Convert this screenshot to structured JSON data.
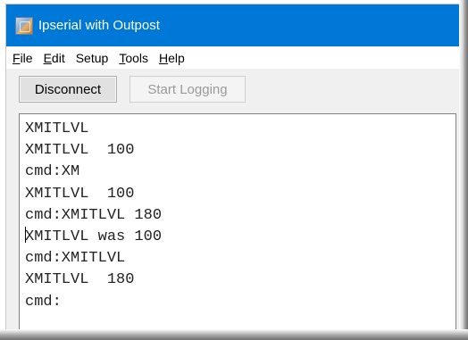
{
  "window": {
    "title": "Ipserial with Outpost",
    "icon": "app-icon"
  },
  "menu": [
    {
      "key": "file",
      "accel": "F",
      "rest": "ile"
    },
    {
      "key": "edit",
      "accel": "E",
      "rest": "dit"
    },
    {
      "key": "setup",
      "accel": "",
      "rest": "Setup"
    },
    {
      "key": "tools",
      "accel": "T",
      "rest": "ools"
    },
    {
      "key": "help",
      "accel": "H",
      "rest": "elp"
    }
  ],
  "toolbar": {
    "disconnect_label": "Disconnect",
    "start_logging_label": "Start Logging",
    "start_logging_enabled": false
  },
  "terminal": {
    "lines": [
      "XMITLVL",
      "XMITLVL  100",
      "cmd:XM",
      "XMITLVL  100",
      "cmd:XMITLVL 180",
      "XMITLVL was 100",
      "cmd:XMITLVL",
      "XMITLVL  180",
      "cmd:"
    ],
    "caret_line_index": 5
  }
}
